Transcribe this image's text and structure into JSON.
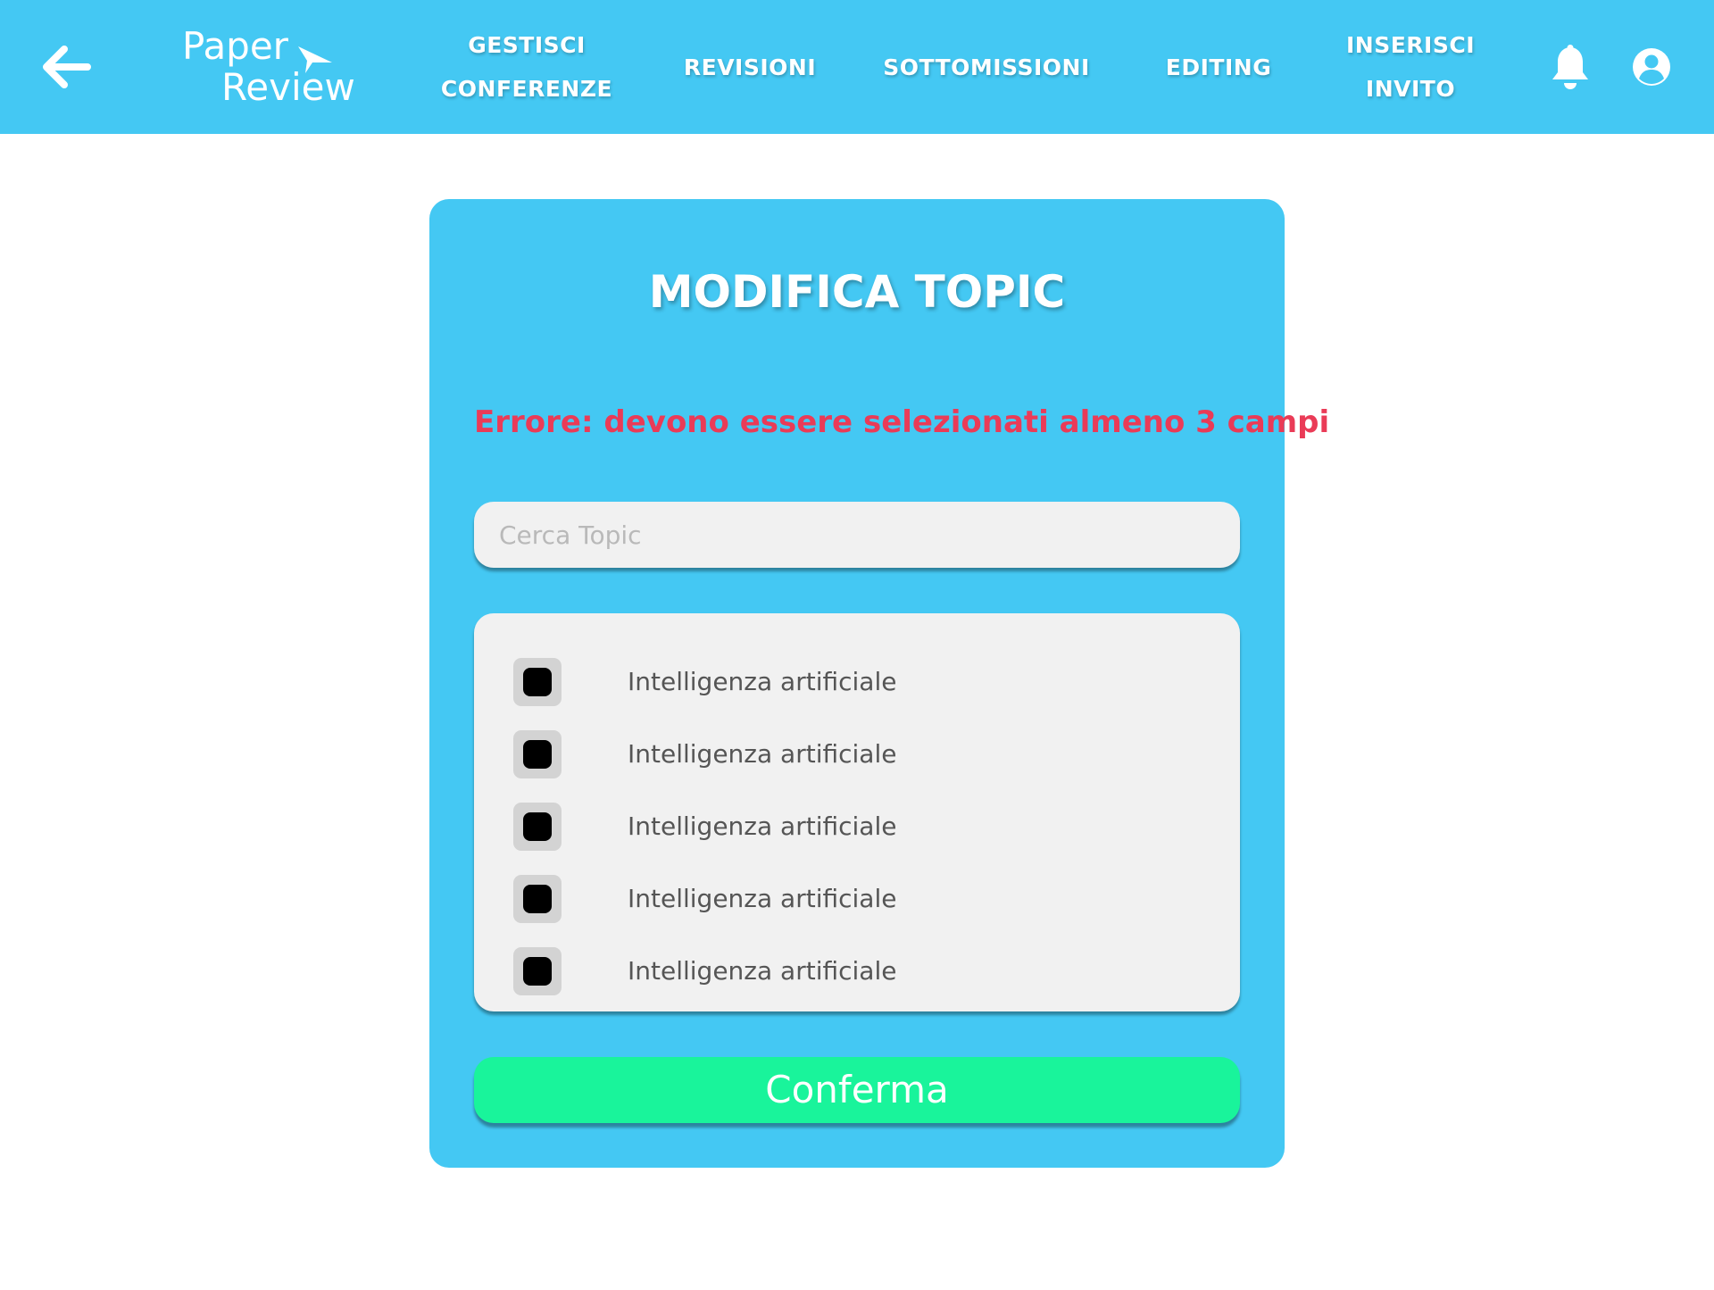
{
  "header": {
    "logo": {
      "line1": "Paper",
      "line2": "Review"
    },
    "nav": [
      {
        "line1": "GESTISCI",
        "line2": "CONFERENZE"
      },
      {
        "line1": "REVISIONI"
      },
      {
        "line1": "SOTTOMISSIONI"
      },
      {
        "line1": "EDITING"
      },
      {
        "line1": "INSERISCI",
        "line2": "INVITO"
      }
    ],
    "icons": {
      "back": "arrow-left-icon",
      "notifications": "bell-icon",
      "account": "user-circle-icon"
    }
  },
  "form": {
    "title": "MODIFICA TOPIC",
    "error": "Errore: devono essere selezionati almeno 3 campi",
    "search": {
      "placeholder": "Cerca Topic",
      "value": ""
    },
    "topics": [
      {
        "label": "Intelligenza artificiale",
        "checked": true
      },
      {
        "label": "Intelligenza artificiale",
        "checked": true
      },
      {
        "label": "Intelligenza artificiale",
        "checked": true
      },
      {
        "label": "Intelligenza artificiale",
        "checked": true
      },
      {
        "label": "Intelligenza artificiale",
        "checked": true
      }
    ],
    "confirm_label": "Conferma"
  },
  "colors": {
    "primary": "#44c8f3",
    "error": "#ea3b57",
    "confirm": "#19f49b",
    "panel": "#f1f1f1"
  }
}
